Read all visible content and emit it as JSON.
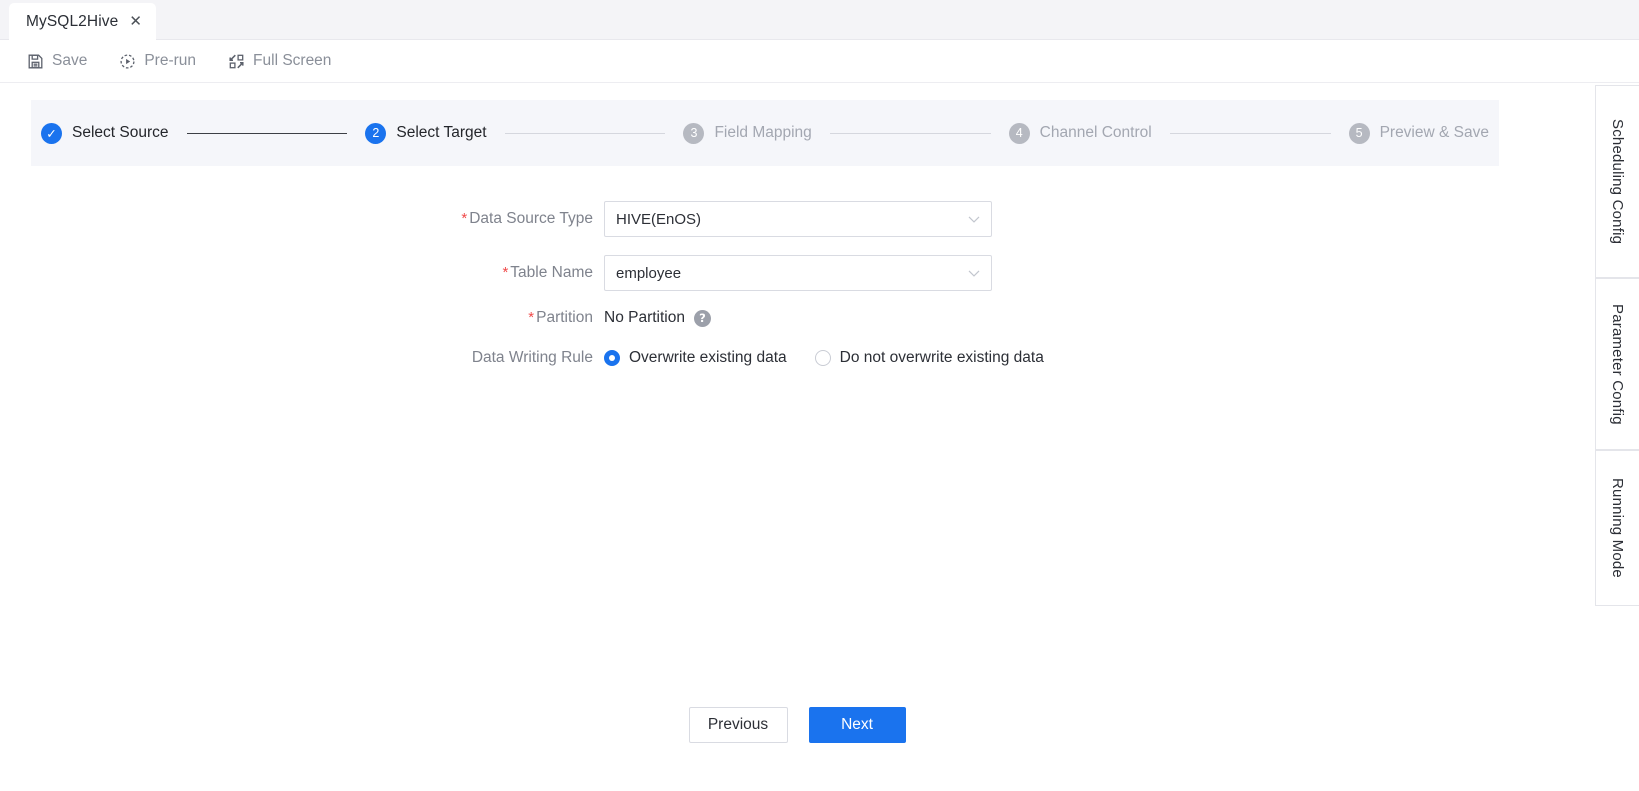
{
  "tab": {
    "title": "MySQL2Hive",
    "close_label": "✕"
  },
  "toolbar": {
    "items": [
      {
        "label": "Save",
        "icon": "save-icon"
      },
      {
        "label": "Pre-run",
        "icon": "play-circle-icon"
      },
      {
        "label": "Full Screen",
        "icon": "fullscreen-icon"
      }
    ]
  },
  "stepper": {
    "steps": [
      {
        "num": "✓",
        "label": "Select Source",
        "state": "done"
      },
      {
        "num": "2",
        "label": "Select Target",
        "state": "active"
      },
      {
        "num": "3",
        "label": "Field Mapping",
        "state": "todo"
      },
      {
        "num": "4",
        "label": "Channel Control",
        "state": "todo"
      },
      {
        "num": "5",
        "label": "Preview & Save",
        "state": "todo"
      }
    ]
  },
  "form": {
    "data_source_type": {
      "label": "Data Source Type",
      "required": "*",
      "value": "HIVE(EnOS)",
      "chevron": "∨"
    },
    "table_name": {
      "label": "Table Name",
      "required": "*",
      "value": "employee",
      "chevron": "∨"
    },
    "partition": {
      "label": "Partition",
      "required": "*",
      "value": "No Partition",
      "help": "?"
    },
    "data_writing_rule": {
      "label": "Data Writing Rule",
      "options": [
        {
          "label": "Overwrite existing data",
          "checked": true
        },
        {
          "label": "Do not overwrite existing data",
          "checked": false
        }
      ]
    }
  },
  "footer": {
    "previous_label": "Previous",
    "next_label": "Next"
  },
  "side_tabs": [
    {
      "label": "Scheduling Config"
    },
    {
      "label": "Parameter Config"
    },
    {
      "label": "Running Mode"
    }
  ],
  "colors": {
    "accent": "#1a73ee",
    "required": "#f04a4a",
    "muted": "#a3a7b1",
    "stepper_bg": "#f5f6fa",
    "tabbar_bg": "#f4f4f7"
  }
}
